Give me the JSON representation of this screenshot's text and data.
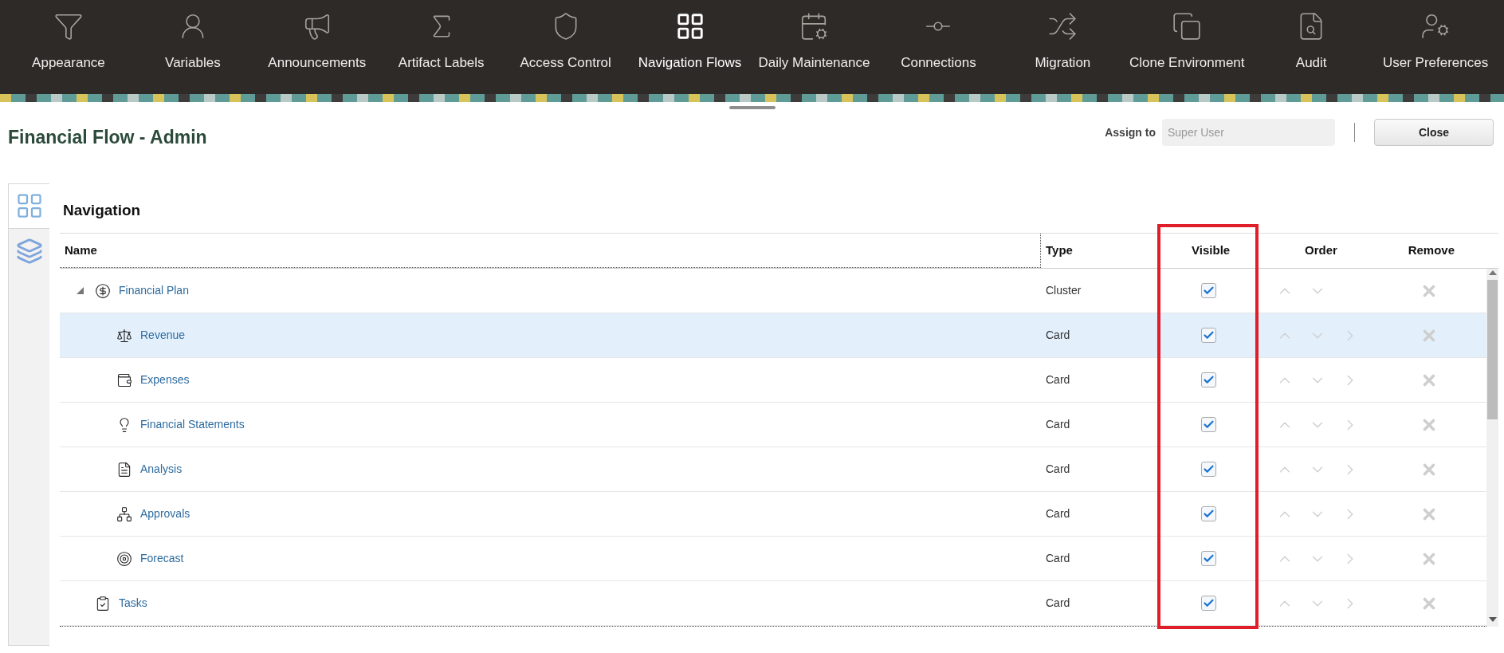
{
  "nav": [
    {
      "label": "Appearance",
      "selected": false
    },
    {
      "label": "Variables",
      "selected": false
    },
    {
      "label": "Announcements",
      "selected": false
    },
    {
      "label": "Artifact Labels",
      "selected": false
    },
    {
      "label": "Access Control",
      "selected": false
    },
    {
      "label": "Navigation Flows",
      "selected": true
    },
    {
      "label": "Daily Maintenance",
      "selected": false
    },
    {
      "label": "Connections",
      "selected": false
    },
    {
      "label": "Migration",
      "selected": false
    },
    {
      "label": "Clone Environment",
      "selected": false
    },
    {
      "label": "Audit",
      "selected": false
    },
    {
      "label": "User Preferences",
      "selected": false
    }
  ],
  "title": "Financial Flow - Admin",
  "assign": {
    "label": "Assign to",
    "placeholder": "Super User"
  },
  "close_button": "Close",
  "side_tabs": [
    {
      "selected": true
    },
    {
      "selected": false
    }
  ],
  "section_title": "Navigation",
  "table": {
    "columns": [
      "Name",
      "Type",
      "Visible",
      "Order",
      "Remove"
    ],
    "rows": [
      {
        "name": "Financial Plan",
        "type": "Cluster",
        "kind": "cluster",
        "visible": true,
        "selected": false,
        "expanded": true,
        "children": [
          {
            "name": "Revenue",
            "type": "Card",
            "kind": "card",
            "visible": true,
            "selected": true
          },
          {
            "name": "Expenses",
            "type": "Card",
            "kind": "card",
            "visible": true,
            "selected": false
          },
          {
            "name": "Financial Statements",
            "type": "Card",
            "kind": "card",
            "visible": true,
            "selected": false
          },
          {
            "name": "Analysis",
            "type": "Card",
            "kind": "card",
            "visible": true,
            "selected": false
          },
          {
            "name": "Approvals",
            "type": "Card",
            "kind": "card",
            "visible": true,
            "selected": false
          },
          {
            "name": "Forecast",
            "type": "Card",
            "kind": "card",
            "visible": true,
            "selected": false
          }
        ]
      },
      {
        "name": "Tasks",
        "type": "Card",
        "kind": "card",
        "visible": true,
        "selected": false
      }
    ]
  }
}
